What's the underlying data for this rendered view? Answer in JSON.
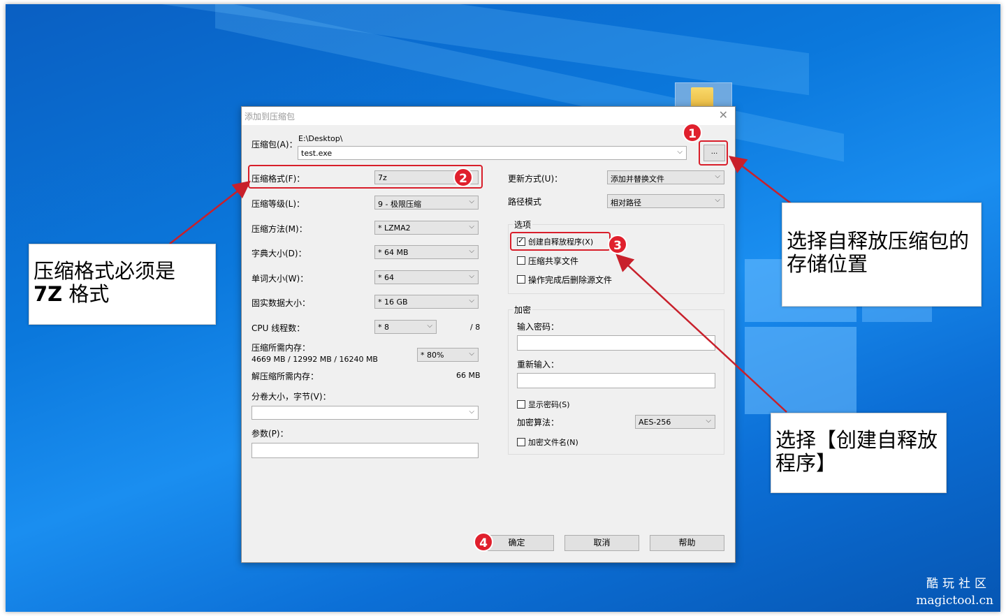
{
  "dialog": {
    "title": "添加到压缩包",
    "archive_label": "压缩包(A)：",
    "archive_path": "E:\\Desktop\\",
    "archive_name": "test.exe",
    "browse_label": "...",
    "left": {
      "format_label": "压缩格式(F)：",
      "format_value": "7z",
      "level_label": "压缩等级(L)：",
      "level_value": "9 - 极限压缩",
      "method_label": "压缩方法(M)：",
      "method_value": "* LZMA2",
      "dict_label": "字典大小(D)：",
      "dict_value": "* 64 MB",
      "word_label": "单词大小(W)：",
      "word_value": "* 64",
      "solid_label": "固实数据大小：",
      "solid_value": "* 16 GB",
      "threads_label": "CPU 线程数：",
      "threads_value": "* 8",
      "threads_max": "/ 8",
      "mem_label": "压缩所需内存：",
      "mem_value": "4669 MB / 12992 MB / 16240 MB",
      "mem_percent": "* 80%",
      "dmem_label": "解压缩所需内存：",
      "dmem_value": "66 MB",
      "volume_label": "分卷大小，字节(V)：",
      "volume_value": "",
      "params_label": "参数(P)：",
      "params_value": ""
    },
    "right": {
      "update_label": "更新方式(U)：",
      "update_value": "添加并替换文件",
      "path_label": "路径模式",
      "path_value": "相对路径",
      "options_title": "选项",
      "opt_sfx": "创建自释放程序(X)",
      "opt_shared": "压缩共享文件",
      "opt_delete": "操作完成后删除源文件",
      "encrypt_title": "加密",
      "pwd_label": "输入密码：",
      "pwd_value": "",
      "repwd_label": "重新输入：",
      "repwd_value": "",
      "show_pwd": "显示密码(S)",
      "algo_label": "加密算法：",
      "algo_value": "AES-256",
      "enc_names": "加密文件名(N)"
    },
    "buttons": {
      "ok": "确定",
      "cancel": "取消",
      "help": "帮助"
    }
  },
  "annotations": {
    "badges": [
      "1",
      "2",
      "3",
      "4"
    ],
    "callout_format": [
      "压缩格式必须是",
      "7Z",
      " 格式"
    ],
    "callout_location": "选择自释放压缩包的存储位置",
    "callout_sfx": "选择【创建自释放程序】",
    "accent_color": "#d81e2a"
  },
  "watermark": {
    "site_cn": "酷玩社区",
    "site_url": "magictool.cn"
  }
}
